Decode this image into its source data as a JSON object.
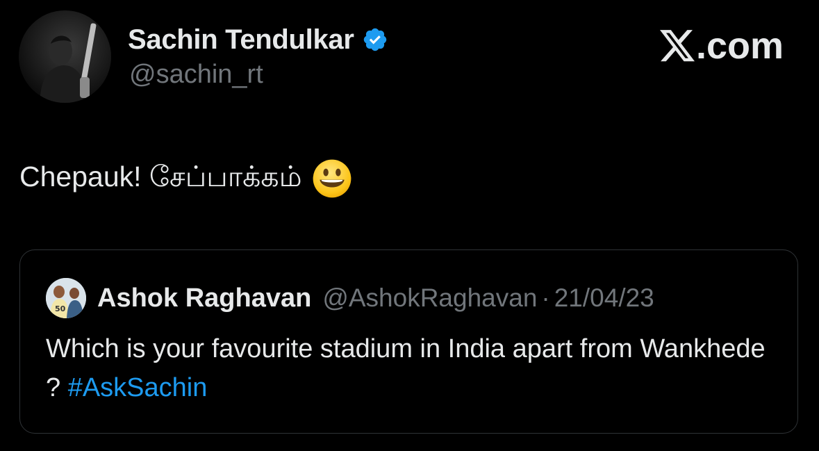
{
  "author": {
    "display_name": "Sachin Tendulkar",
    "handle": "@sachin_rt",
    "verified_icon": "verified-badge-icon",
    "verified_color": "#1d9bf0"
  },
  "brand": {
    "label": ".com",
    "logo_icon": "x-logo-icon"
  },
  "tweet": {
    "text": "Chepauk! சேப்பாக்கம்",
    "emoji_icon": "grinning-face-emoji-icon"
  },
  "quoted_tweet": {
    "display_name": "Ashok Raghavan",
    "handle": "@AshokRaghavan",
    "separator": "·",
    "date": "21/04/23",
    "text": "Which is your favourite stadium in India apart from Wankhede ? ",
    "hashtag": "#AskSachin",
    "hashtag_color": "#1d9bf0"
  },
  "colors": {
    "background": "#000000",
    "primary_text": "#e7e9ea",
    "secondary_text": "#71767b",
    "card_border": "#2f3336"
  }
}
